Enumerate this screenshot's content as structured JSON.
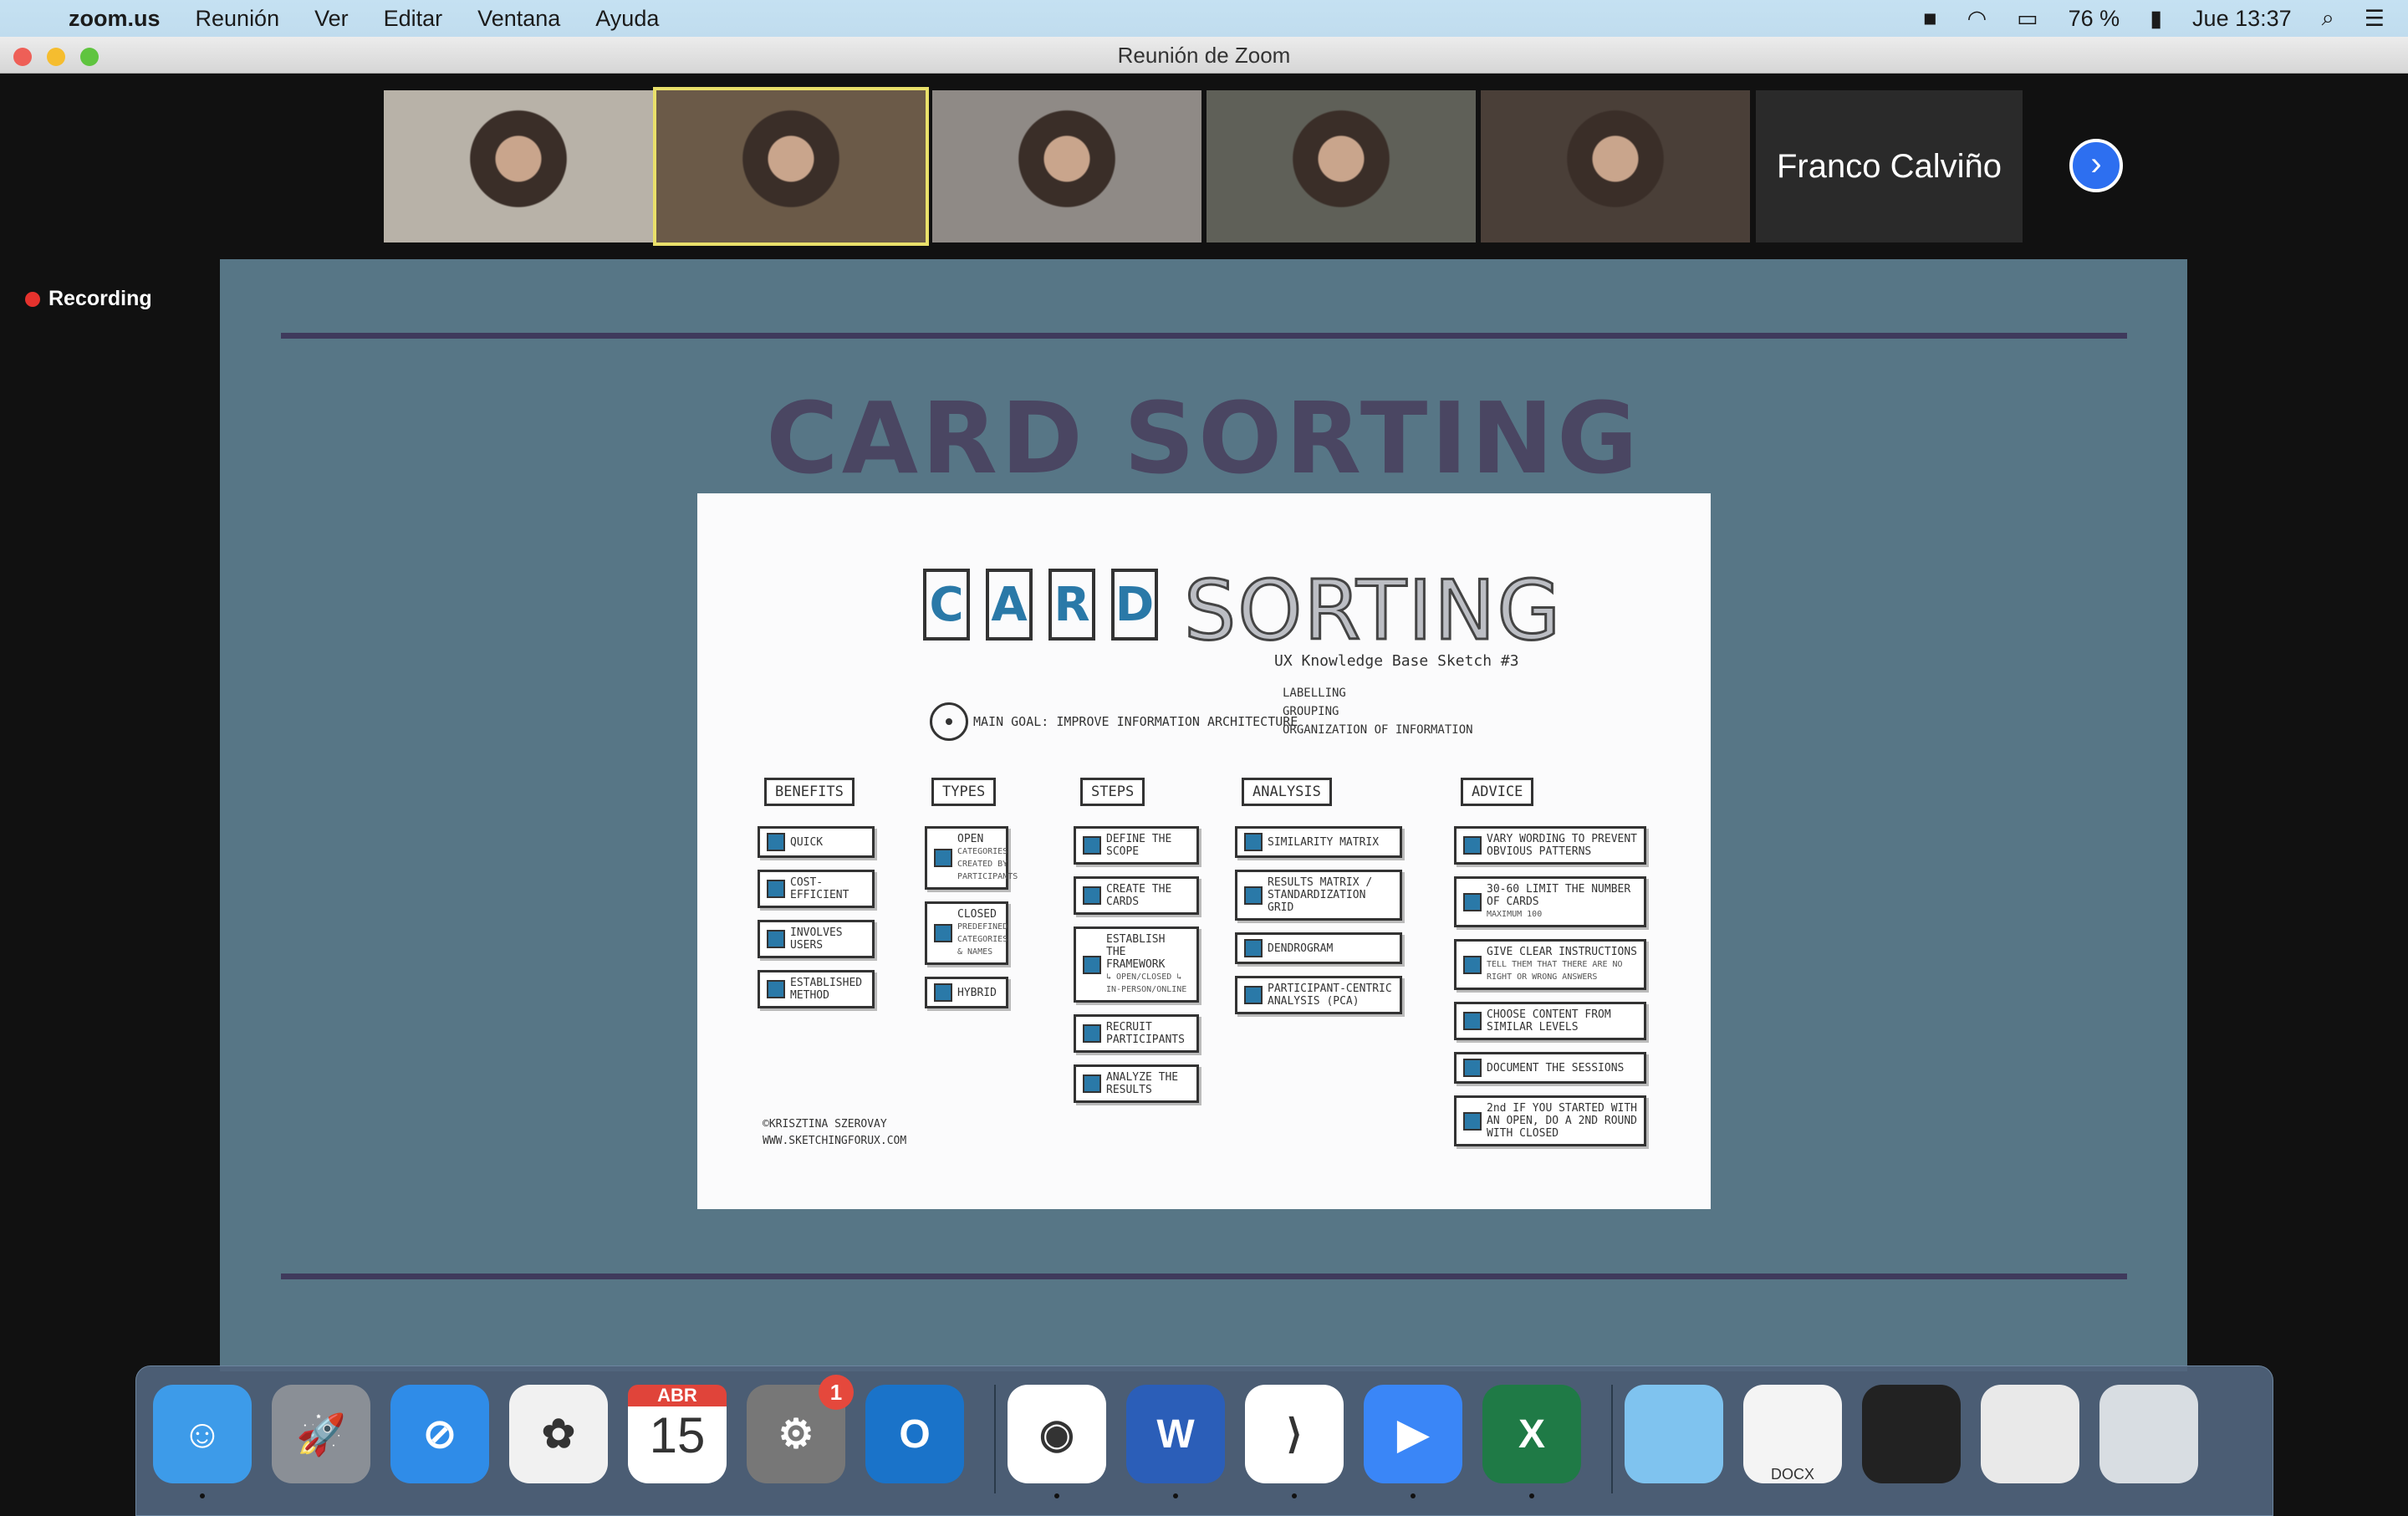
{
  "menubar": {
    "app": "zoom.us",
    "items": [
      "Reunión",
      "Ver",
      "Editar",
      "Ventana",
      "Ayuda"
    ],
    "battery": "76 %",
    "clock": "Jue 13:37"
  },
  "window": {
    "title": "Reunión de Zoom"
  },
  "participants": {
    "tiles": [
      {
        "bg": "#b8b2a8"
      },
      {
        "bg": "#6b5a48",
        "active": true
      },
      {
        "bg": "#8f8a86"
      },
      {
        "bg": "#5f6058"
      },
      {
        "bg": "#4a3f38"
      }
    ],
    "name_tile": "Franco Calviño"
  },
  "recording": "Recording",
  "slide": {
    "title": "CARD SORTING",
    "sketch": {
      "letters": [
        "C",
        "A",
        "R",
        "D"
      ],
      "title_rest": "SORTING",
      "subtitle": "UX Knowledge Base Sketch #3",
      "goal": "MAIN GOAL: IMPROVE INFORMATION ARCHITECTURE",
      "goal_branches": [
        "LABELLING",
        "GROUPING",
        "ORGANIZATION OF INFORMATION"
      ],
      "columns": [
        {
          "header": "BENEFITS",
          "cards": [
            {
              "t": "QUICK"
            },
            {
              "t": "COST-EFFICIENT"
            },
            {
              "t": "INVOLVES USERS"
            },
            {
              "t": "ESTABLISHED METHOD"
            }
          ]
        },
        {
          "header": "TYPES",
          "cards": [
            {
              "t": "OPEN",
              "s": "CATEGORIES CREATED BY PARTICIPANTS"
            },
            {
              "t": "CLOSED",
              "s": "PREDEFINED CATEGORIES & NAMES"
            },
            {
              "t": "HYBRID"
            }
          ]
        },
        {
          "header": "STEPS",
          "cards": [
            {
              "t": "DEFINE THE SCOPE"
            },
            {
              "t": "CREATE THE CARDS"
            },
            {
              "t": "ESTABLISH THE FRAMEWORK",
              "s": "↳ OPEN/CLOSED ↳ IN-PERSON/ONLINE"
            },
            {
              "t": "RECRUIT PARTICIPANTS"
            },
            {
              "t": "ANALYZE THE RESULTS"
            }
          ]
        },
        {
          "header": "ANALYSIS",
          "cards": [
            {
              "t": "SIMILARITY MATRIX"
            },
            {
              "t": "RESULTS MATRIX / STANDARDIZATION GRID"
            },
            {
              "t": "DENDROGRAM"
            },
            {
              "t": "PARTICIPANT-CENTRIC ANALYSIS (PCA)"
            }
          ]
        },
        {
          "header": "ADVICE",
          "cards": [
            {
              "t": "VARY WORDING TO PREVENT OBVIOUS PATTERNS"
            },
            {
              "t": "30-60 LIMIT THE NUMBER OF CARDS",
              "s": "MAXIMUM 100"
            },
            {
              "t": "GIVE CLEAR INSTRUCTIONS",
              "s": "TELL THEM THAT THERE ARE NO RIGHT OR WRONG ANSWERS"
            },
            {
              "t": "CHOOSE CONTENT FROM SIMILAR LEVELS"
            },
            {
              "t": "DOCUMENT THE SESSIONS"
            },
            {
              "t": "2nd IF YOU STARTED WITH AN OPEN, DO A 2ND ROUND WITH CLOSED"
            }
          ]
        }
      ],
      "credit": [
        "©KRISZTINA SZEROVAY",
        "WWW.SKETCHINGFORUX.COM"
      ]
    }
  },
  "dock": {
    "items": [
      {
        "name": "finder",
        "color": "#3d9be9",
        "label": "☺",
        "dot": true
      },
      {
        "name": "launchpad",
        "color": "#8a8f96",
        "label": "🚀"
      },
      {
        "name": "safari",
        "color": "#2f8ce8",
        "label": "⊘"
      },
      {
        "name": "photos",
        "color": "#f1f1f1",
        "label": "✿"
      },
      {
        "name": "calendar",
        "color": "#ffffff",
        "label": "15",
        "month": "ABR"
      },
      {
        "name": "system-preferences",
        "color": "#777",
        "label": "⚙",
        "badge": "1"
      },
      {
        "name": "outlook",
        "color": "#1a73c9",
        "label": "O"
      },
      {
        "sep": true
      },
      {
        "name": "chrome",
        "color": "#ffffff",
        "label": "◉",
        "dot": true
      },
      {
        "name": "word",
        "color": "#2b5eb8",
        "label": "W",
        "dot": true
      },
      {
        "name": "vscode",
        "color": "#ffffff",
        "label": "⟩",
        "dot": true
      },
      {
        "name": "zoom",
        "color": "#3a86f7",
        "label": "▶",
        "dot": true
      },
      {
        "name": "excel",
        "color": "#1f7a46",
        "label": "X",
        "dot": true
      },
      {
        "sep": true
      },
      {
        "name": "downloads-folder",
        "color": "#7fc3ef",
        "label": ""
      },
      {
        "name": "docx-document",
        "color": "#f4f4f4",
        "label": "DOCX"
      },
      {
        "name": "vscode-window",
        "color": "#222",
        "label": ""
      },
      {
        "name": "chrome-window",
        "color": "#e9e9e9",
        "label": ""
      },
      {
        "name": "trash",
        "color": "#d8dde2",
        "label": ""
      }
    ]
  }
}
